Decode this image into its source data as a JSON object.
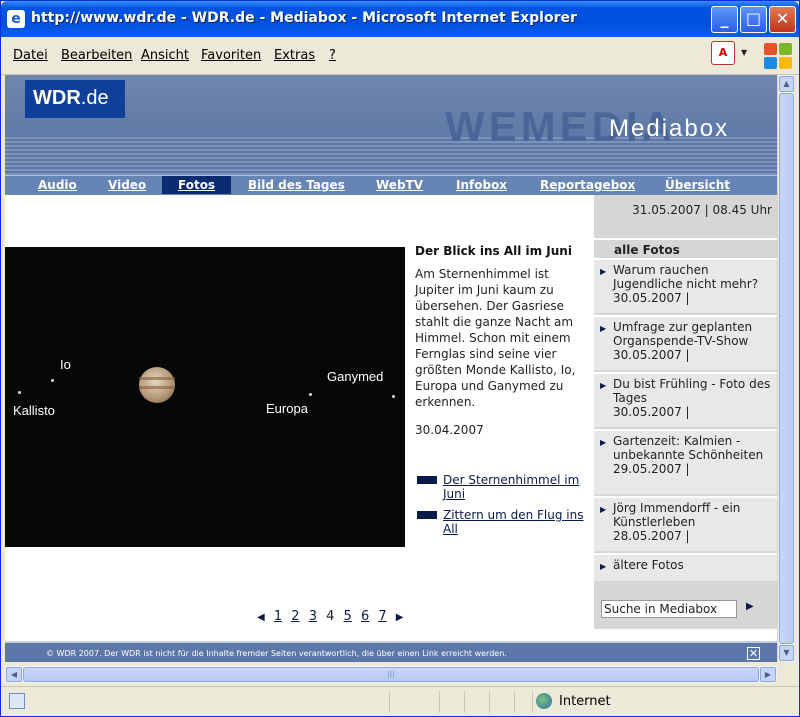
{
  "window": {
    "title": "http://www.wdr.de - WDR.de - Mediabox - Microsoft Internet Explorer"
  },
  "menu": [
    "Datei",
    "Bearbeiten",
    "Ansicht",
    "Favoriten",
    "Extras",
    "?"
  ],
  "site": {
    "logo_wdr": "WDR",
    "logo_de": ".de",
    "section_title": "Mediabox",
    "ghost_text": "WEMEDIA"
  },
  "nav": {
    "items": [
      "Audio",
      "Video",
      "Fotos",
      "Bild des Tages",
      "WebTV",
      "Infobox",
      "Reportagebox",
      "Übersicht"
    ],
    "active": "Fotos"
  },
  "photo": {
    "labels": {
      "io": "Io",
      "kallisto": "Kallisto",
      "ganymed": "Ganymed",
      "europa": "Europa"
    }
  },
  "article": {
    "title": "Der Blick ins All im Juni",
    "body": "Am Sternenhimmel ist Jupiter im Juni kaum zu übersehen. Der Gasriese stahlt die ganze Nacht am Himmel. Schon mit einem Fernglas sind seine vier größten Monde Kallisto, Io, Europa und Ganymed zu erkennen.",
    "date": "30.04.2007",
    "related": [
      "Der Sternenhimmel im Juni",
      "Zittern um den Flug ins All"
    ]
  },
  "pager": {
    "pages": [
      "1",
      "2",
      "3",
      "4",
      "5",
      "6",
      "7"
    ],
    "current": "4"
  },
  "sidebar": {
    "datetime": "31.05.2007 | 08.45 Uhr",
    "heading": "alle Fotos",
    "items": [
      {
        "title": "Warum rauchen Jugendliche nicht mehr?",
        "date": "30.05.2007 |"
      },
      {
        "title": "Umfrage zur geplanten Organspende-TV-Show",
        "date": "30.05.2007 |"
      },
      {
        "title": "Du bist Frühling - Foto des Tages",
        "date": "30.05.2007 |"
      },
      {
        "title": "Gartenzeit: Kalmien - unbekannte Schönheiten",
        "date": "29.05.2007 |"
      },
      {
        "title": "Jörg Immendorff - ein Künstlerleben",
        "date": "28.05.2007 |"
      }
    ],
    "more": "ältere Fotos",
    "search_value": "Suche in Mediabox"
  },
  "footer": {
    "text": "© WDR 2007. Der WDR ist nicht für die Inhalte fremder Seiten verantwortlich, die über einen Link erreicht werden."
  },
  "status": {
    "zone": "Internet"
  },
  "colors": {
    "title_bar": "#0050dd",
    "header_blue": "#5673a4",
    "nav_active": "#0a2b72",
    "logo_blue": "#0e3f99"
  }
}
